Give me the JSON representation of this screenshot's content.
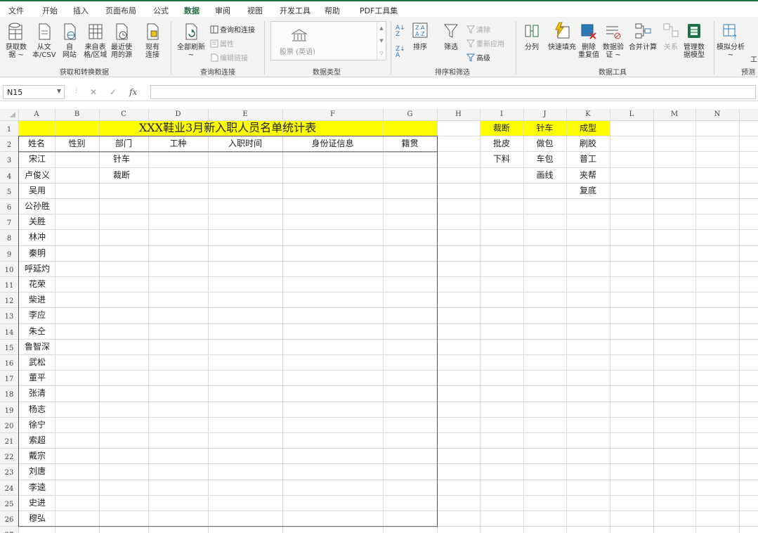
{
  "menu": [
    "文件",
    "开始",
    "插入",
    "页面布局",
    "公式",
    "数据",
    "审阅",
    "视图",
    "开发工具",
    "帮助",
    "PDF工具集"
  ],
  "active_tab": "数据",
  "ribbon": {
    "get_data": [
      "获取数",
      "据 ~"
    ],
    "from_text": [
      "从文",
      "本/CSV"
    ],
    "from_web": [
      "自",
      "网站"
    ],
    "from_table": [
      "来自表",
      "格/区域"
    ],
    "recent": [
      "最近使",
      "用的源"
    ],
    "existing": [
      "现有",
      "连接"
    ],
    "group_get": "获取和转换数据",
    "refresh_all": [
      "全部刷新",
      "~"
    ],
    "queries_conn": "查询和连接",
    "properties": "属性",
    "edit_links": "编辑链接",
    "group_query": "查询和连接",
    "stocks": "股票 (英语)",
    "group_types": "数据类型",
    "sort": "排序",
    "filter": "筛选",
    "clear": "清除",
    "reapply": "重新应用",
    "advanced": "高级",
    "group_sort": "排序和筛选",
    "split": "分列",
    "flash_fill": "快速填充",
    "remove_dup": [
      "删除",
      "重复值"
    ],
    "validation": [
      "数据验",
      "证 ~"
    ],
    "consolidate": "合并计算",
    "relations": "关系",
    "manage_model": [
      "管理数",
      "据模型"
    ],
    "group_tools": "数据工具",
    "whatif": [
      "模拟分析",
      "~"
    ],
    "forecast_sheet": "工",
    "group_forecast": "预测"
  },
  "formula_bar": {
    "name_box": "N15",
    "fx": "fx",
    "formula": ""
  },
  "columns": [
    "A",
    "B",
    "C",
    "D",
    "E",
    "F",
    "G",
    "H",
    "I",
    "J",
    "K",
    "L",
    "M",
    "N"
  ],
  "rows": [
    "1",
    "2",
    "3",
    "4",
    "5",
    "6",
    "7",
    "8",
    "9",
    "10",
    "11",
    "12",
    "13",
    "14",
    "15",
    "16",
    "17",
    "18",
    "19",
    "20",
    "21",
    "22",
    "23",
    "24",
    "25",
    "26",
    "27"
  ],
  "sheet": {
    "title": "XXX鞋业3月新入职人员名单统计表",
    "headers": [
      "姓名",
      "性别",
      "部门",
      "工种",
      "入职时间",
      "身份证信息",
      "籍贯"
    ],
    "names": [
      "宋江",
      "卢俊义",
      "吴用",
      "公孙胜",
      "关胜",
      "林冲",
      "秦明",
      "呼延灼",
      "花荣",
      "柴进",
      "李应",
      "朱仝",
      "鲁智深",
      "武松",
      "董平",
      "张清",
      "杨志",
      "徐宁",
      "索超",
      "戴宗",
      "刘唐",
      "李逵",
      "史进",
      "穆弘"
    ],
    "dept": [
      "针车",
      "裁断"
    ],
    "lists": {
      "I": [
        "裁断",
        "批皮",
        "下料"
      ],
      "J": [
        "针车",
        "做包",
        "车包",
        "画线"
      ],
      "K": [
        "成型",
        "刷胶",
        "普工",
        "夹帮",
        "复底"
      ]
    }
  },
  "colors": {
    "accent": "#1e6f41",
    "highlight": "#ffff00"
  }
}
